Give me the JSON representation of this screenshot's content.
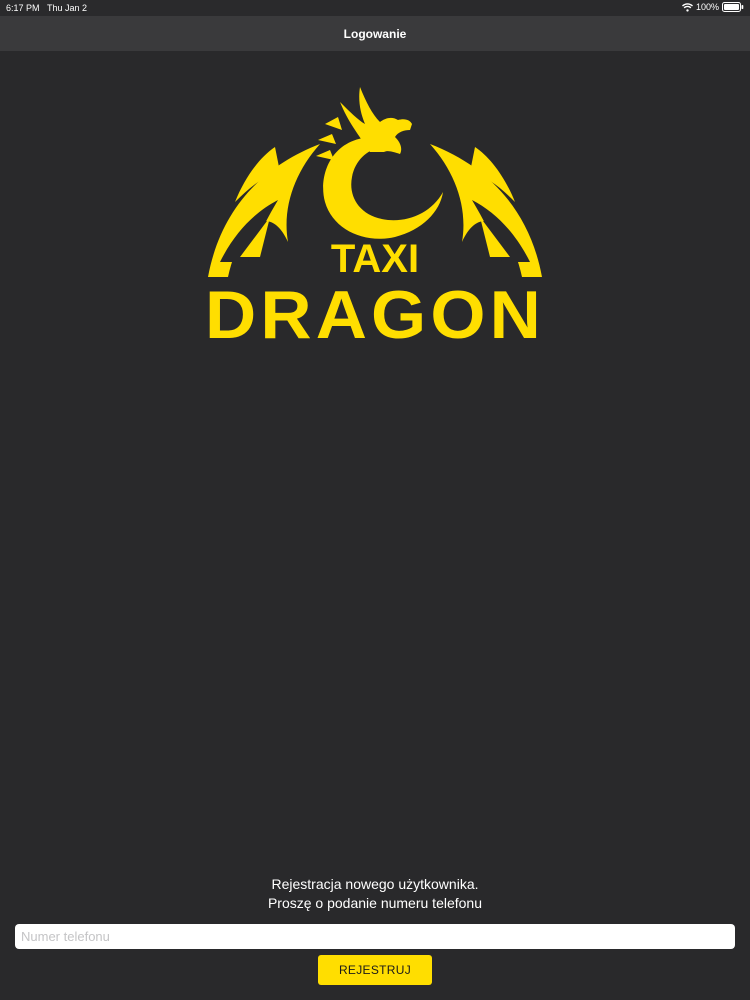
{
  "status_bar": {
    "time": "6:17 PM",
    "date": "Thu Jan 2",
    "battery": "100%",
    "icons": [
      "wifi-icon",
      "battery-icon"
    ]
  },
  "nav": {
    "title": "Logowanie"
  },
  "logo": {
    "line1": "TAXI",
    "line2": "DRAGON",
    "icon": "dragon-icon",
    "color": "#ffde00"
  },
  "registration": {
    "line1": "Rejestracja nowego użytkownika.",
    "line2": "Proszę o podanie numeru telefonu",
    "phone_value": "",
    "phone_placeholder": "Numer telefonu",
    "button_label": "REJESTRUJ"
  },
  "colors": {
    "background": "#29292b",
    "nav_background": "#3a3a3c",
    "accent": "#ffde00",
    "text": "#ffffff"
  }
}
